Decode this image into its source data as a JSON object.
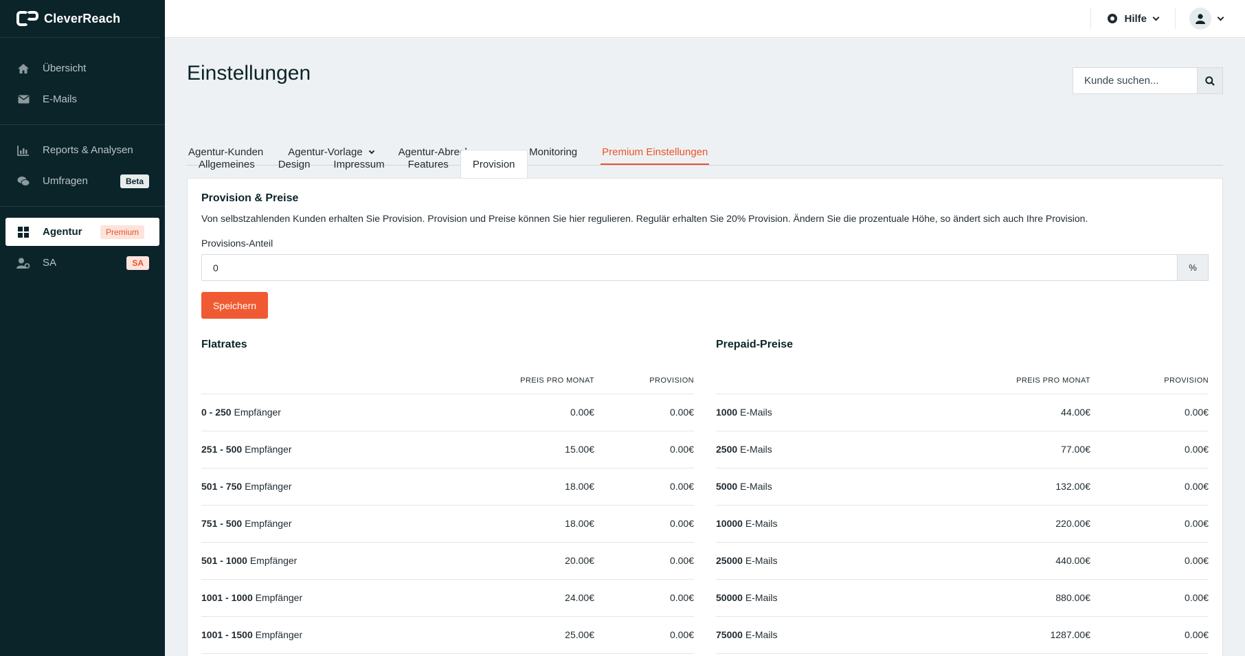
{
  "app": {
    "name": "CleverReach"
  },
  "sidebar": {
    "items": [
      {
        "label": "Übersicht",
        "icon": "home-icon"
      },
      {
        "label": "E-Mails",
        "icon": "envelope-icon"
      },
      {
        "label": "Reports & Analysen",
        "icon": "bar-chart-icon"
      },
      {
        "label": "Umfragen",
        "icon": "chat-bubbles-icon",
        "badge": "Beta"
      },
      {
        "label": "Agentur",
        "icon": "grid-icon",
        "badge": "Premium",
        "active": true
      },
      {
        "label": "SA",
        "icon": "user-settings-icon",
        "badge": "SA"
      }
    ]
  },
  "topbar": {
    "help_label": "Hilfe"
  },
  "page": {
    "title": "Einstellungen",
    "search_placeholder": "Kunde suchen..."
  },
  "main_tabs": [
    {
      "label": "Agentur-Kunden"
    },
    {
      "label": "Agentur-Vorlage",
      "dropdown": true
    },
    {
      "label": "Agentur-Abrechnung",
      "dropdown": true
    },
    {
      "label": "Monitoring"
    },
    {
      "label": "Premium Einstellungen",
      "active": true
    }
  ],
  "sub_tabs": [
    {
      "label": "Allgemeines"
    },
    {
      "label": "Design"
    },
    {
      "label": "Impressum"
    },
    {
      "label": "Features"
    },
    {
      "label": "Provision",
      "active": true
    }
  ],
  "provision": {
    "heading": "Provision & Preise",
    "description": "Von selbstzahlenden Kunden erhalten Sie Provision. Provision und Preise können Sie hier regulieren. Regulär erhalten Sie 20% Provision. Ändern Sie die prozentuale Höhe, so ändert sich auch Ihre Provision.",
    "field_label": "Provisions-Anteil",
    "field_value": "0",
    "addon": "%",
    "save_label": "Speichern"
  },
  "flatrates": {
    "heading": "Flatrates",
    "col_price": "PREIS PRO MONAT",
    "col_provision": "PROVISION",
    "rows": [
      {
        "range": "0 - 250",
        "unit": "Empfänger",
        "price": "0.00€",
        "provision": "0.00€"
      },
      {
        "range": "251 - 500",
        "unit": "Empfänger",
        "price": "15.00€",
        "provision": "0.00€"
      },
      {
        "range": "501 - 750",
        "unit": "Empfänger",
        "price": "18.00€",
        "provision": "0.00€"
      },
      {
        "range": "751 - 500",
        "unit": "Empfänger",
        "price": "18.00€",
        "provision": "0.00€"
      },
      {
        "range": "501 - 1000",
        "unit": "Empfänger",
        "price": "20.00€",
        "provision": "0.00€"
      },
      {
        "range": "1001 - 1000",
        "unit": "Empfänger",
        "price": "24.00€",
        "provision": "0.00€"
      },
      {
        "range": "1001 - 1500",
        "unit": "Empfänger",
        "price": "25.00€",
        "provision": "0.00€"
      }
    ]
  },
  "prepaid": {
    "heading": "Prepaid-Preise",
    "col_price": "PREIS PRO MONAT",
    "col_provision": "PROVISION",
    "rows": [
      {
        "range": "1000",
        "unit": "E-Mails",
        "price": "44.00€",
        "provision": "0.00€"
      },
      {
        "range": "2500",
        "unit": "E-Mails",
        "price": "77.00€",
        "provision": "0.00€"
      },
      {
        "range": "5000",
        "unit": "E-Mails",
        "price": "132.00€",
        "provision": "0.00€"
      },
      {
        "range": "10000",
        "unit": "E-Mails",
        "price": "220.00€",
        "provision": "0.00€"
      },
      {
        "range": "25000",
        "unit": "E-Mails",
        "price": "440.00€",
        "provision": "0.00€"
      },
      {
        "range": "50000",
        "unit": "E-Mails",
        "price": "880.00€",
        "provision": "0.00€"
      },
      {
        "range": "75000",
        "unit": "E-Mails",
        "price": "1287.00€",
        "provision": "0.00€"
      }
    ]
  },
  "colors": {
    "sidebar_bg": "#0b2429",
    "accent": "#e8532b",
    "button": "#f05a32"
  }
}
